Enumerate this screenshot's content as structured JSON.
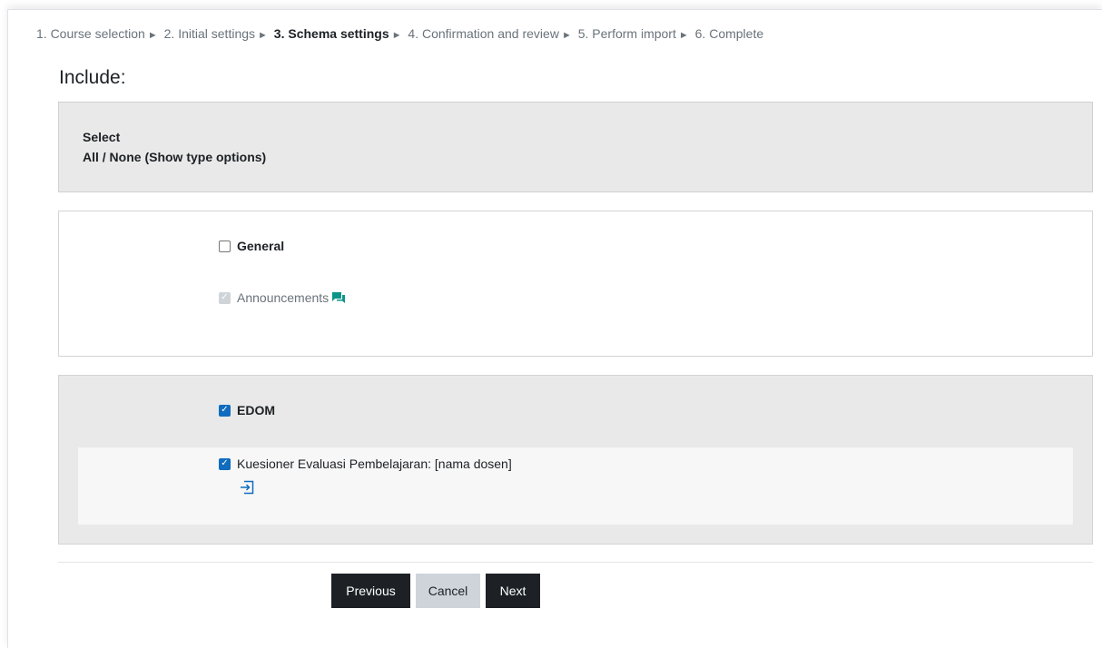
{
  "progress": {
    "steps": [
      {
        "label": "1. Course selection"
      },
      {
        "label": "2. Initial settings"
      },
      {
        "label": "3. Schema settings",
        "current": true
      },
      {
        "label": "4. Confirmation and review"
      },
      {
        "label": "5. Perform import"
      },
      {
        "label": "6. Complete"
      }
    ],
    "separator": "►"
  },
  "include": {
    "title": "Include:"
  },
  "select": {
    "label": "Select",
    "options": "All / None (Show type options)"
  },
  "sections": [
    {
      "name": "General",
      "checked": false,
      "activities": [
        {
          "name": "Announcements",
          "checked": true,
          "disabled": true,
          "icon": "forum-icon"
        }
      ]
    },
    {
      "name": "EDOM",
      "checked": true,
      "activities": [
        {
          "name": "Kuesioner Evaluasi Pembelajaran: [nama dosen]",
          "checked": true,
          "icon": "feedback-icon"
        }
      ]
    }
  ],
  "buttons": {
    "previous": "Previous",
    "cancel": "Cancel",
    "next": "Next"
  },
  "colors": {
    "accent": "#0f6cbf",
    "dark_button": "#1d2125",
    "icon_teal": "#0d9488"
  }
}
